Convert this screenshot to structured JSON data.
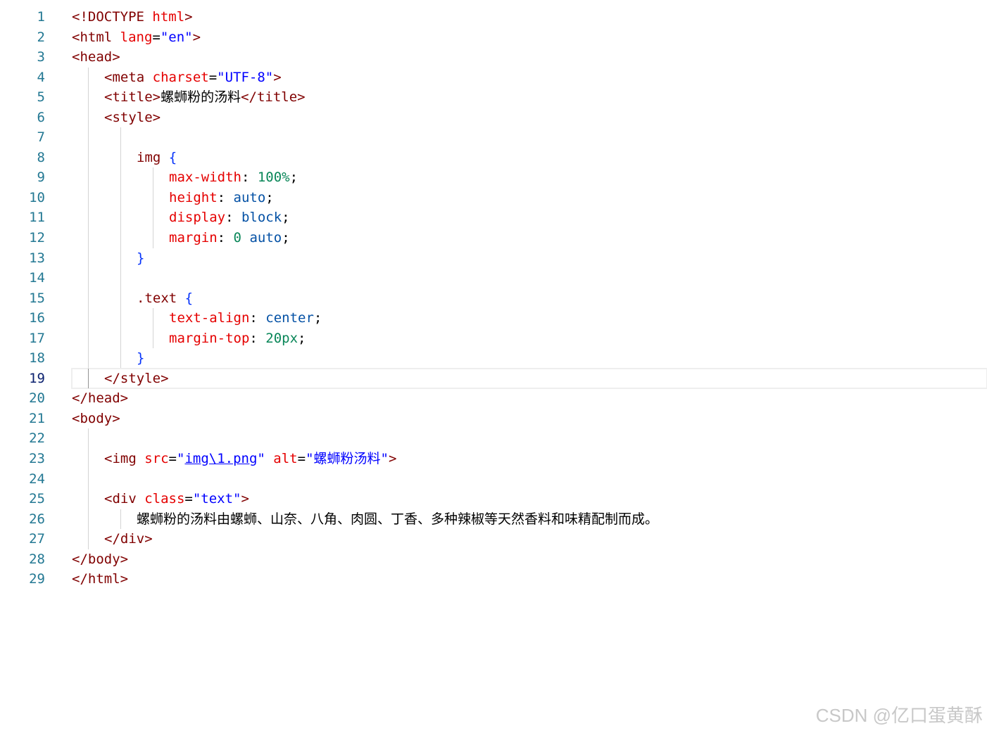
{
  "editor": {
    "active_line": 19,
    "lines": [
      {
        "n": "1",
        "indent": 0,
        "tokens": [
          [
            "tag",
            "<!DOCTYPE "
          ],
          [
            "attr",
            "html"
          ],
          [
            "tag",
            ">"
          ]
        ]
      },
      {
        "n": "2",
        "indent": 0,
        "tokens": [
          [
            "tag",
            "<html "
          ],
          [
            "attr",
            "lang"
          ],
          [
            "plain",
            "="
          ],
          [
            "str",
            "\"en\""
          ],
          [
            "tag",
            ">"
          ]
        ]
      },
      {
        "n": "3",
        "indent": 0,
        "tokens": [
          [
            "tag",
            "<head>"
          ]
        ]
      },
      {
        "n": "4",
        "indent": 1,
        "tokens": [
          [
            "tag",
            "<meta "
          ],
          [
            "attr",
            "charset"
          ],
          [
            "plain",
            "="
          ],
          [
            "str",
            "\"UTF-8\""
          ],
          [
            "tag",
            ">"
          ]
        ]
      },
      {
        "n": "5",
        "indent": 1,
        "tokens": [
          [
            "tag",
            "<title>"
          ],
          [
            "cjk",
            "螺蛳粉的汤料"
          ],
          [
            "tag",
            "</title>"
          ]
        ]
      },
      {
        "n": "6",
        "indent": 1,
        "tokens": [
          [
            "tag",
            "<style>"
          ]
        ]
      },
      {
        "n": "7",
        "indent": 2,
        "tokens": []
      },
      {
        "n": "8",
        "indent": 2,
        "tokens": [
          [
            "sel",
            "img "
          ],
          [
            "brace",
            "{"
          ]
        ]
      },
      {
        "n": "9",
        "indent": 3,
        "tokens": [
          [
            "prop",
            "max-width"
          ],
          [
            "plain",
            ": "
          ],
          [
            "num",
            "100%"
          ],
          [
            "plain",
            ";"
          ]
        ]
      },
      {
        "n": "10",
        "indent": 3,
        "tokens": [
          [
            "prop",
            "height"
          ],
          [
            "plain",
            ": "
          ],
          [
            "kw",
            "auto"
          ],
          [
            "plain",
            ";"
          ]
        ]
      },
      {
        "n": "11",
        "indent": 3,
        "tokens": [
          [
            "prop",
            "display"
          ],
          [
            "plain",
            ": "
          ],
          [
            "kw",
            "block"
          ],
          [
            "plain",
            ";"
          ]
        ]
      },
      {
        "n": "12",
        "indent": 3,
        "tokens": [
          [
            "prop",
            "margin"
          ],
          [
            "plain",
            ": "
          ],
          [
            "num",
            "0"
          ],
          [
            "plain",
            " "
          ],
          [
            "kw",
            "auto"
          ],
          [
            "plain",
            ";"
          ]
        ]
      },
      {
        "n": "13",
        "indent": 2,
        "tokens": [
          [
            "brace",
            "}"
          ]
        ]
      },
      {
        "n": "14",
        "indent": 2,
        "tokens": []
      },
      {
        "n": "15",
        "indent": 2,
        "tokens": [
          [
            "sel",
            ".text "
          ],
          [
            "brace",
            "{"
          ]
        ]
      },
      {
        "n": "16",
        "indent": 3,
        "tokens": [
          [
            "prop",
            "text-align"
          ],
          [
            "plain",
            ": "
          ],
          [
            "kw",
            "center"
          ],
          [
            "plain",
            ";"
          ]
        ]
      },
      {
        "n": "17",
        "indent": 3,
        "tokens": [
          [
            "prop",
            "margin-top"
          ],
          [
            "plain",
            ": "
          ],
          [
            "num",
            "20px"
          ],
          [
            "plain",
            ";"
          ]
        ]
      },
      {
        "n": "18",
        "indent": 2,
        "tokens": [
          [
            "brace",
            "}"
          ]
        ]
      },
      {
        "n": "19",
        "indent": 1,
        "tokens": [
          [
            "tag",
            "</style>"
          ]
        ]
      },
      {
        "n": "20",
        "indent": 0,
        "tokens": [
          [
            "tag",
            "</head>"
          ]
        ]
      },
      {
        "n": "21",
        "indent": 0,
        "tokens": [
          [
            "tag",
            "<body>"
          ]
        ]
      },
      {
        "n": "22",
        "indent": 1,
        "tokens": []
      },
      {
        "n": "23",
        "indent": 1,
        "tokens": [
          [
            "tag",
            "<img "
          ],
          [
            "attr",
            "src"
          ],
          [
            "plain",
            "="
          ],
          [
            "str",
            "\""
          ],
          [
            "link",
            "img\\1.png"
          ],
          [
            "str",
            "\""
          ],
          [
            "plain",
            " "
          ],
          [
            "attr",
            "alt"
          ],
          [
            "plain",
            "="
          ],
          [
            "str",
            "\""
          ],
          [
            "cjkstr",
            "螺蛳粉汤料"
          ],
          [
            "str",
            "\""
          ],
          [
            "tag",
            ">"
          ]
        ]
      },
      {
        "n": "24",
        "indent": 1,
        "tokens": []
      },
      {
        "n": "25",
        "indent": 1,
        "tokens": [
          [
            "tag",
            "<div "
          ],
          [
            "attr",
            "class"
          ],
          [
            "plain",
            "="
          ],
          [
            "str",
            "\"text\""
          ],
          [
            "tag",
            ">"
          ]
        ]
      },
      {
        "n": "26",
        "indent": 2,
        "tokens": [
          [
            "cjk",
            "螺蛳粉的汤料由螺蛳、山奈、八角、肉圆、丁香、多种辣椒等天然香料和味精配制而成。"
          ]
        ]
      },
      {
        "n": "27",
        "indent": 1,
        "tokens": [
          [
            "tag",
            "</div>"
          ]
        ]
      },
      {
        "n": "28",
        "indent": 0,
        "tokens": [
          [
            "tag",
            "</body>"
          ]
        ]
      },
      {
        "n": "29",
        "indent": 0,
        "tokens": [
          [
            "tag",
            "</html>"
          ]
        ]
      }
    ]
  },
  "watermark": "CSDN @亿口蛋黄酥"
}
